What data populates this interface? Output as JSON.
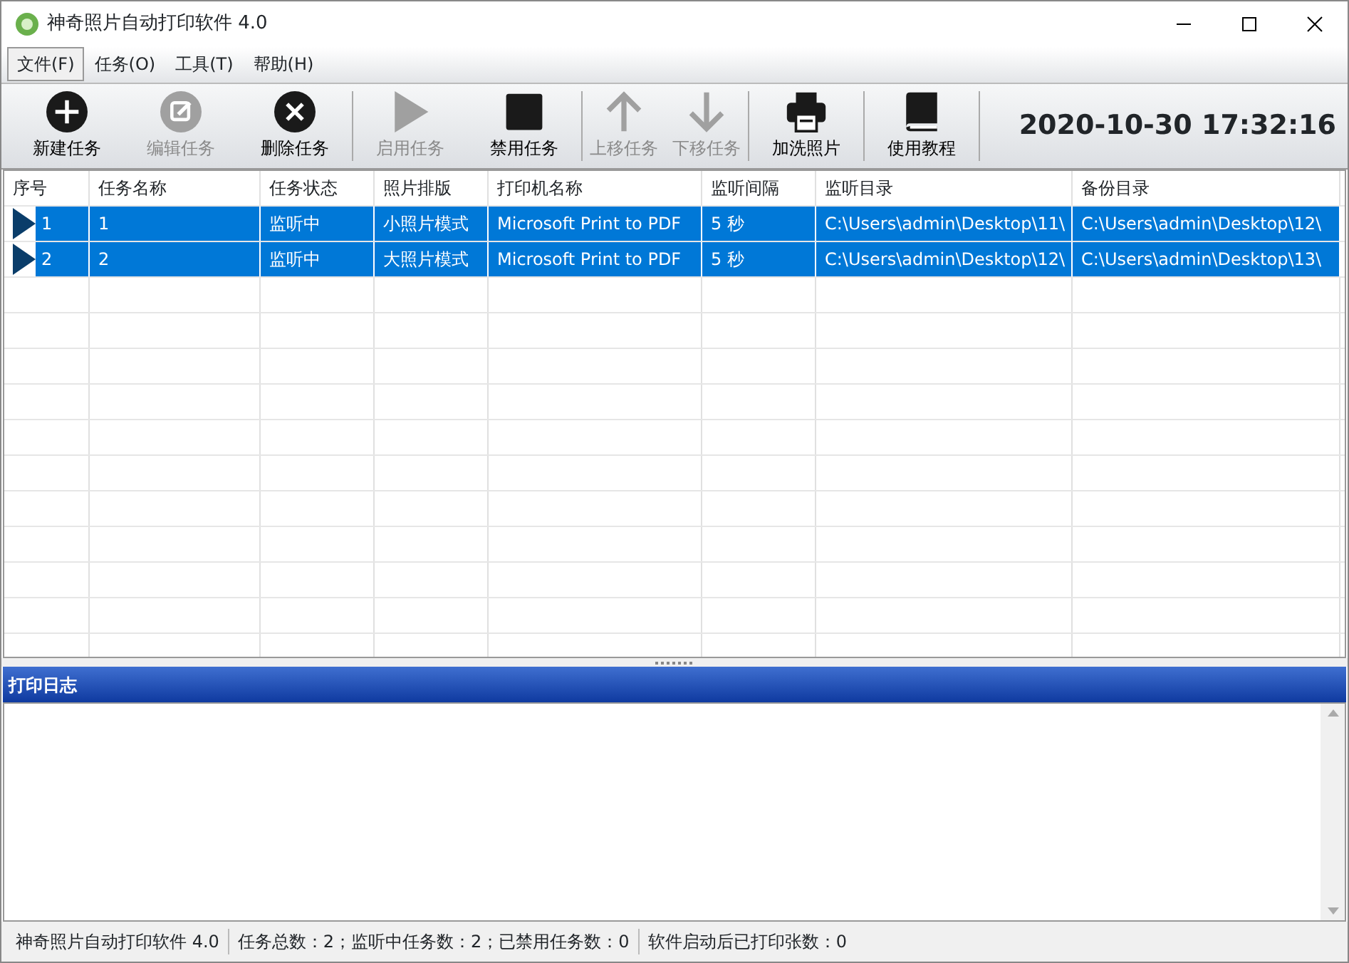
{
  "window": {
    "title": "神奇照片自动打印软件 4.0"
  },
  "menu": [
    {
      "label": "文件(F)",
      "selected": true
    },
    {
      "label": "任务(O)",
      "selected": false
    },
    {
      "label": "工具(T)",
      "selected": false
    },
    {
      "label": "帮助(H)",
      "selected": false
    }
  ],
  "toolbar": [
    [
      {
        "label": "新建任务",
        "disabled": false
      },
      {
        "label": "编辑任务",
        "disabled": true
      },
      {
        "label": "删除任务",
        "disabled": false
      }
    ],
    [
      {
        "label": "启用任务",
        "disabled": true
      },
      {
        "label": "禁用任务",
        "disabled": false
      }
    ],
    [
      {
        "label": "上移任务",
        "disabled": true
      },
      {
        "label": "下移任务",
        "disabled": true
      }
    ],
    [
      {
        "label": "加洗照片",
        "disabled": false
      }
    ],
    [
      {
        "label": "使用教程",
        "disabled": false
      }
    ]
  ],
  "clock": "2020-10-30 17:32:16",
  "table": {
    "columns": [
      "序号",
      "任务名称",
      "任务状态",
      "照片排版",
      "打印机名称",
      "监听间隔",
      "监听目录",
      "备份目录"
    ],
    "rows": [
      {
        "selected": true,
        "cells": [
          "1",
          "1",
          "监听中",
          "小照片模式",
          "Microsoft Print to PDF",
          "5 秒",
          "C:\\Users\\admin\\Desktop\\11\\",
          "C:\\Users\\admin\\Desktop\\12\\"
        ]
      },
      {
        "selected": true,
        "cells": [
          "2",
          "2",
          "监听中",
          "大照片模式",
          "Microsoft Print to PDF",
          "5 秒",
          "C:\\Users\\admin\\Desktop\\12\\",
          "C:\\Users\\admin\\Desktop\\13\\"
        ]
      }
    ]
  },
  "log": {
    "title": "打印日志"
  },
  "status_bar": [
    "神奇照片自动打印软件 4.0",
    "任务总数：2；监听中任务数：2；已禁用任务数：0",
    "软件启动后已打印张数：0"
  ]
}
